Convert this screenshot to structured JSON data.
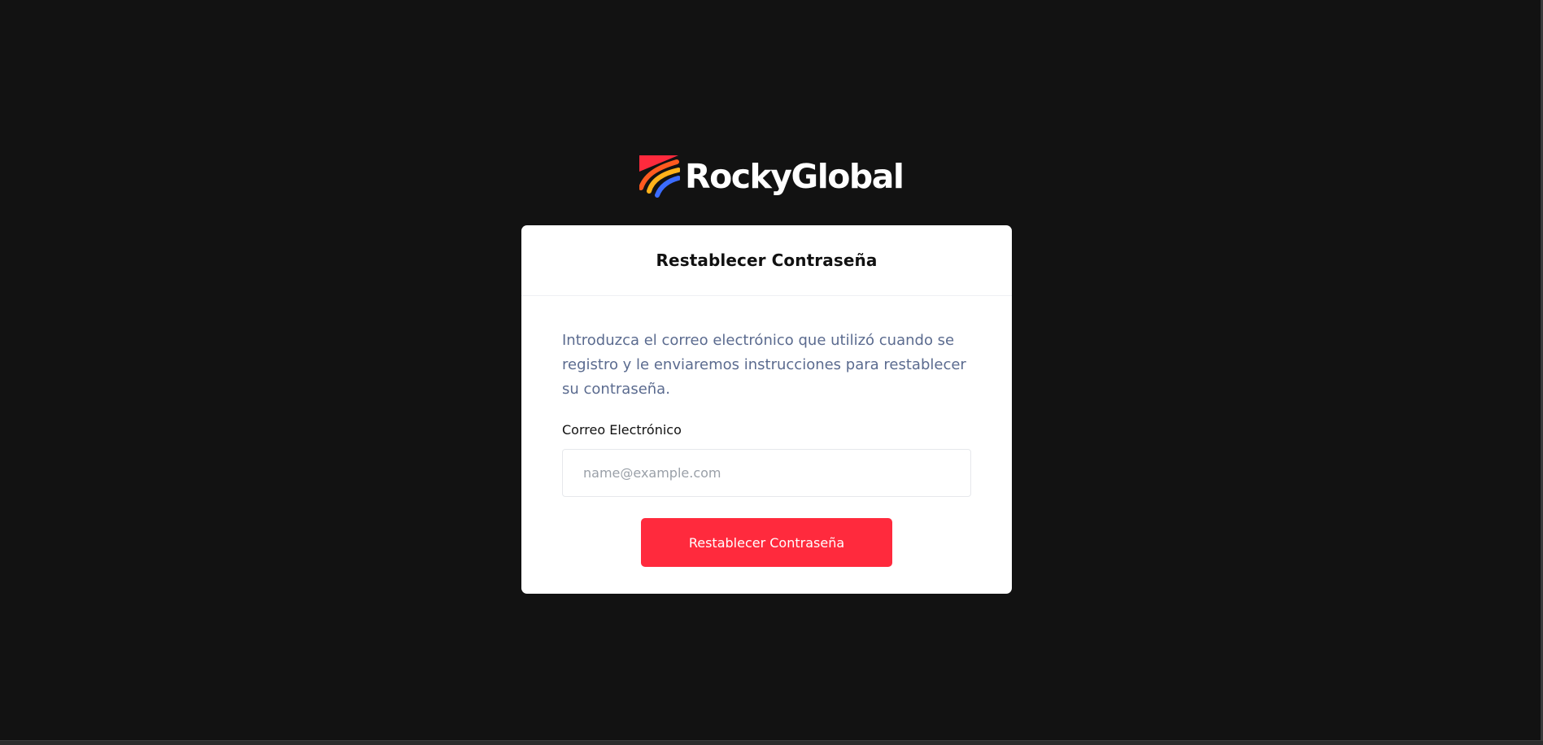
{
  "brand": {
    "name": "RockyGlobal",
    "logo_icon": "rockyglobal-logo-mark-icon",
    "colors": {
      "red": "#ff2a3d",
      "orange": "#ff7a1a",
      "yellow": "#ffb21a",
      "blue": "#3b6cff"
    }
  },
  "card": {
    "title": "Restablecer Contraseña",
    "intro": "Introduzca el correo electrónico que utilizó cuando se registro y le enviaremos instrucciones para restablecer su contraseña.",
    "email_label": "Correo Electrónico",
    "email_value": "",
    "email_placeholder": "name@example.com",
    "submit_label": "Restablecer Contraseña"
  },
  "theme": {
    "background": "#121212",
    "card_background": "#ffffff",
    "accent": "#ff2a3d",
    "muted_text": "#5b6b8f"
  }
}
